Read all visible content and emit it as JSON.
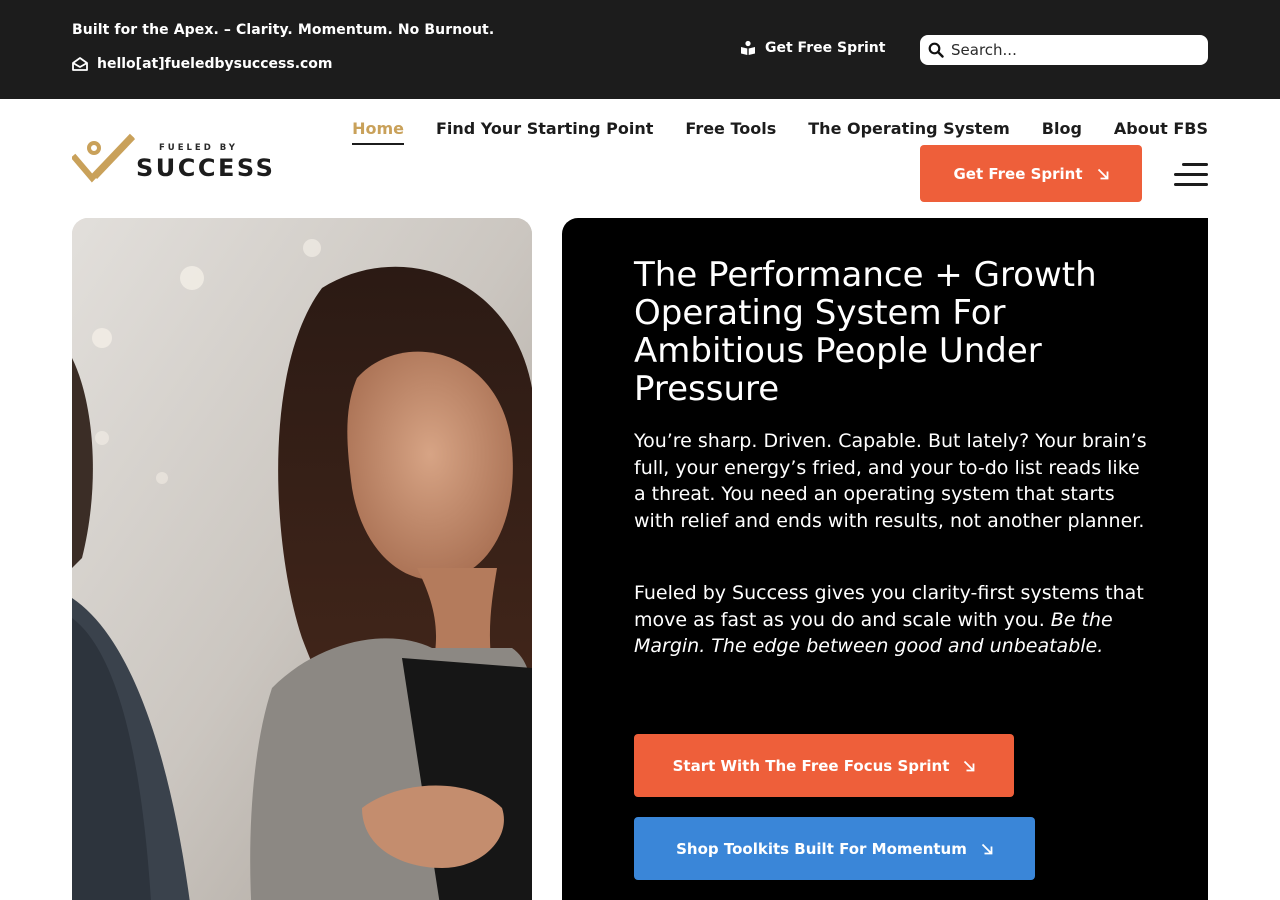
{
  "topbar": {
    "tagline": "Built for the Apex. – Clarity. Momentum. No Burnout.",
    "email": "hello[at]fueledbysuccess.com",
    "sprint_link": "Get Free Sprint",
    "search_placeholder": "Search..."
  },
  "logo": {
    "line1": "FUELED BY",
    "line2": "SUCCESS"
  },
  "nav": {
    "items": [
      {
        "label": "Home",
        "active": true
      },
      {
        "label": "Find Your Starting Point"
      },
      {
        "label": "Free Tools"
      },
      {
        "label": "The Operating System"
      },
      {
        "label": "Blog"
      },
      {
        "label": "About FBS"
      }
    ],
    "cta": "Get Free Sprint"
  },
  "hero": {
    "title": "The Performance + Growth Operating System For Ambitious People Under Pressure",
    "paragraph1": "You’re sharp. Driven. Capable. But lately? Your brain’s full, your energy’s fried, and your to-do list reads like a threat. You need an operating system that starts with relief and ends with results, not another planner.",
    "paragraph2_lead": "Fueled by Success gives you clarity-first systems that move as fast as you do and scale with you.",
    "paragraph2_italic": "Be the Margin. The edge between good and unbeatable.",
    "primary_cta": "Start With The Free Focus Sprint",
    "secondary_cta": "Shop Toolkits Built For Momentum"
  },
  "colors": {
    "accent_orange": "#ee5f3a",
    "accent_blue": "#3a86d8",
    "gold": "#c9a15a",
    "dark": "#1c1c1c"
  },
  "icons": {
    "email": "envelope-open-icon",
    "sprint": "book-reader-icon",
    "search": "search-icon",
    "arrow": "arrow-down-right-icon",
    "menu": "hamburger-icon"
  }
}
